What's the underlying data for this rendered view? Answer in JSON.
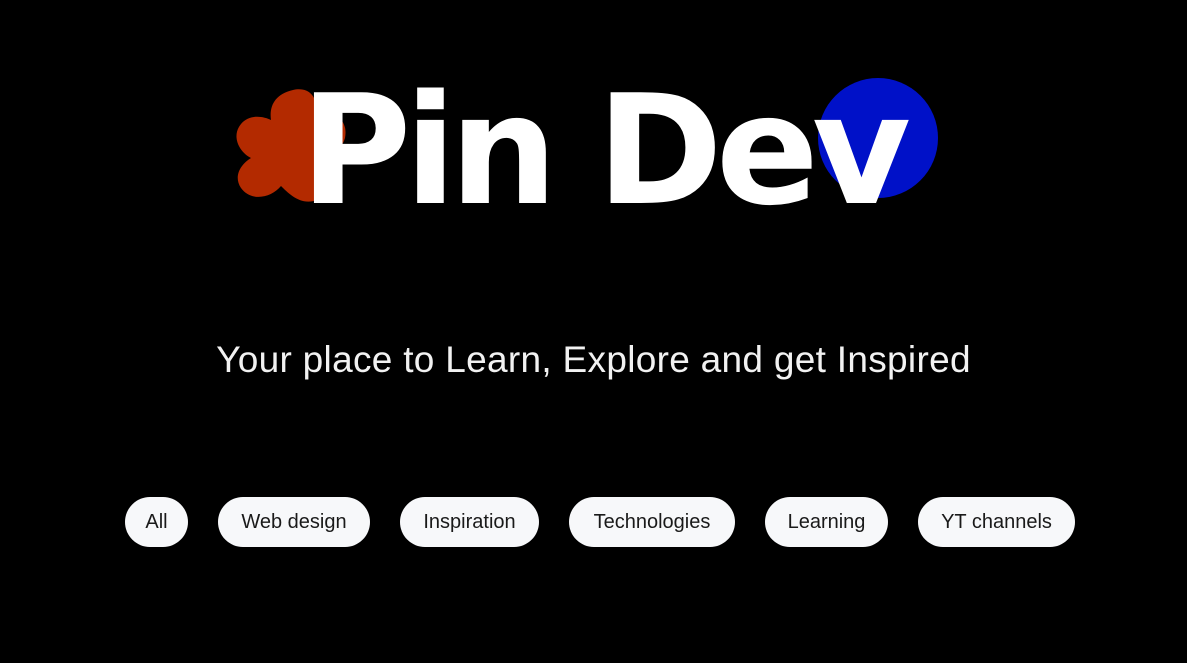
{
  "logo": {
    "text": "Pin Dev",
    "blob_color": "#b32a00",
    "circle_color": "#0011c8",
    "text_color": "#ffffff"
  },
  "tagline": "Your place to Learn, Explore and get Inspired",
  "filters": [
    {
      "label": "All"
    },
    {
      "label": "Web design"
    },
    {
      "label": "Inspiration"
    },
    {
      "label": "Technologies"
    },
    {
      "label": "Learning"
    },
    {
      "label": "YT channels"
    }
  ],
  "colors": {
    "background": "#000000",
    "pill_background": "#f7f8fa",
    "pill_text": "#1a1a1a"
  }
}
